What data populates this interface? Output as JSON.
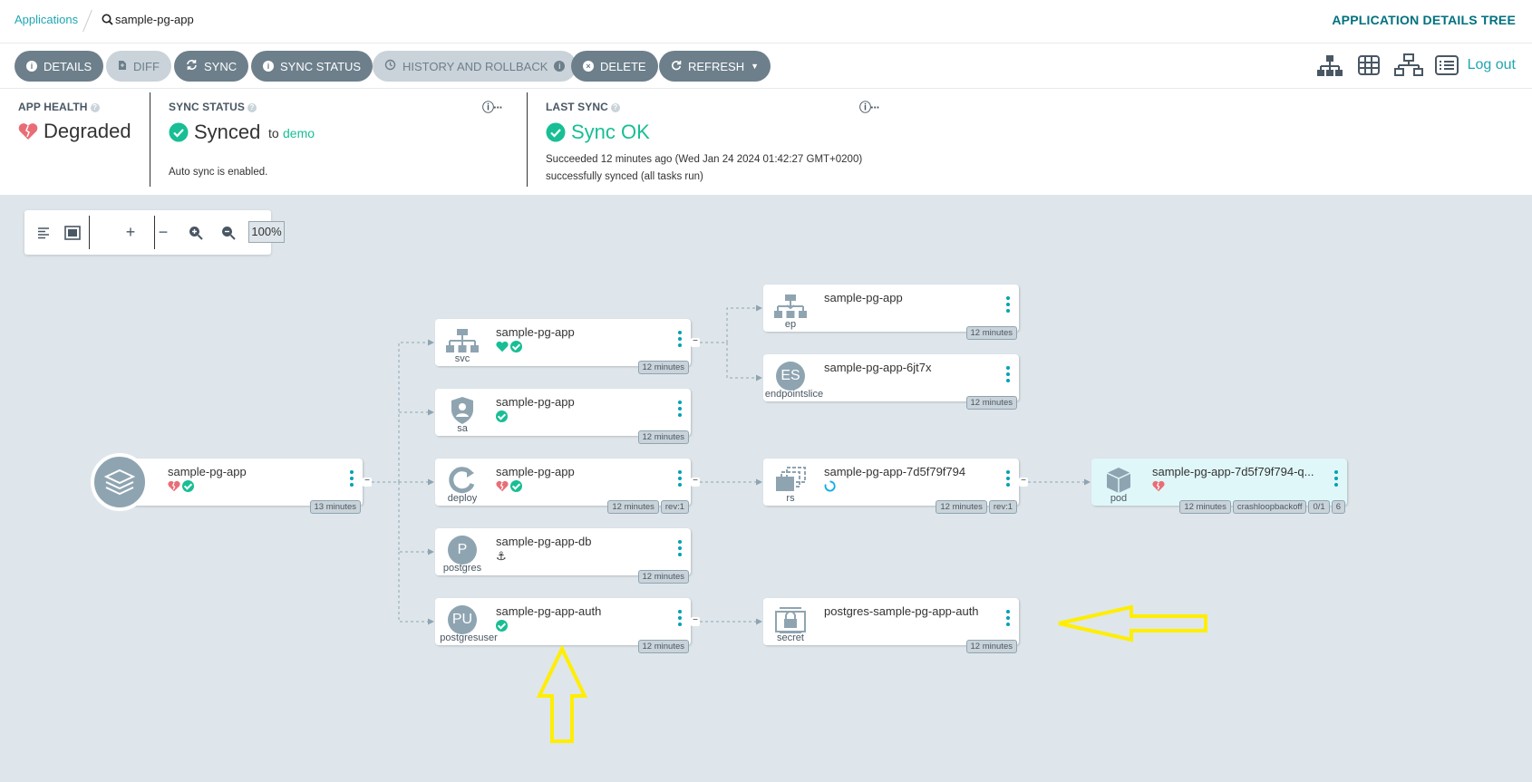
{
  "breadcrumb": {
    "applications": "Applications",
    "app": "sample-pg-app"
  },
  "view_title": "APPLICATION DETAILS TREE",
  "toolbar": {
    "details": "DETAILS",
    "diff": "DIFF",
    "sync": "SYNC",
    "sync_status": "SYNC STATUS",
    "history": "HISTORY AND ROLLBACK",
    "delete": "DELETE",
    "refresh": "REFRESH",
    "logout": "Log out"
  },
  "status": {
    "health_label": "APP HEALTH",
    "health_value": "Degraded",
    "sync_label": "SYNC STATUS",
    "sync_value": "Synced",
    "sync_to": "to",
    "sync_target": "demo",
    "auto_sync": "Auto sync is enabled.",
    "last_sync_label": "LAST SYNC",
    "last_sync_value": "Sync OK",
    "last_sync_detail": "Succeeded 12 minutes ago (Wed Jan 24 2024 01:42:27 GMT+0200)",
    "last_sync_msg": "successfully synced (all tasks run)"
  },
  "zoom": {
    "level": "100%"
  },
  "colors": {
    "accent": "#1fa6b3",
    "healthy": "#18be94",
    "degraded": "#e96d76",
    "button": "#6d7f8b",
    "canvas": "#dee6eb"
  },
  "nodes": {
    "app": {
      "name": "sample-pg-app",
      "tags": [
        "13 minutes"
      ]
    },
    "svc": {
      "kind": "svc",
      "name": "sample-pg-app",
      "tags": [
        "12 minutes"
      ]
    },
    "sa": {
      "kind": "sa",
      "name": "sample-pg-app",
      "tags": [
        "12 minutes"
      ]
    },
    "deploy": {
      "kind": "deploy",
      "name": "sample-pg-app",
      "tags": [
        "12 minutes",
        "rev:1"
      ]
    },
    "postgres": {
      "kind": "postgres",
      "icon_letter": "P",
      "name": "sample-pg-app-db",
      "tags": [
        "12 minutes"
      ]
    },
    "pguser": {
      "kind": "postgresuser",
      "icon_letter": "PU",
      "name": "sample-pg-app-auth",
      "tags": [
        "12 minutes"
      ]
    },
    "ep": {
      "kind": "ep",
      "name": "sample-pg-app",
      "tags": [
        "12 minutes"
      ]
    },
    "es": {
      "kind": "endpointslice",
      "icon_letter": "ES",
      "name": "sample-pg-app-6jt7x",
      "tags": [
        "12 minutes"
      ]
    },
    "rs": {
      "kind": "rs",
      "name": "sample-pg-app-7d5f79f794",
      "tags": [
        "12 minutes",
        "rev:1"
      ]
    },
    "secret": {
      "kind": "secret",
      "name": "postgres-sample-pg-app-auth",
      "tags": [
        "12 minutes"
      ]
    },
    "pod": {
      "kind": "pod",
      "name": "sample-pg-app-7d5f79f794-q...",
      "tags": [
        "12 minutes",
        "crashloopbackoff",
        "0/1",
        "6"
      ]
    }
  }
}
